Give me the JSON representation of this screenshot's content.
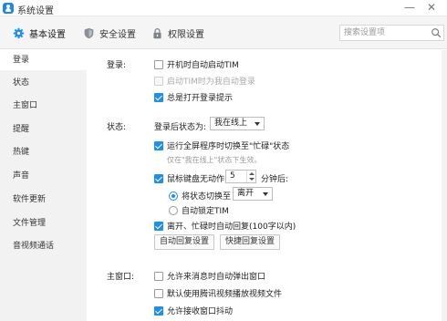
{
  "window": {
    "title": "系统设置",
    "minimize_glyph": "—",
    "close_glyph": "✕"
  },
  "tabs": [
    {
      "label": "基本设置",
      "icon": "gear-icon"
    },
    {
      "label": "安全设置",
      "icon": "shield-icon"
    },
    {
      "label": "权限设置",
      "icon": "lock-icon"
    }
  ],
  "search": {
    "placeholder": "搜索设置项",
    "value": ""
  },
  "sidebar": {
    "items": [
      {
        "label": "登录",
        "active": true
      },
      {
        "label": "状态"
      },
      {
        "label": "主窗口"
      },
      {
        "label": "提醒"
      },
      {
        "label": "热键"
      },
      {
        "label": "声音"
      },
      {
        "label": "软件更新"
      },
      {
        "label": "文件管理"
      },
      {
        "label": "音视频通话"
      }
    ]
  },
  "login": {
    "section_label": "登录:",
    "auto_start": {
      "label": "开机时自动启动TIM",
      "checked": false
    },
    "auto_login": {
      "label": "启动TIM时为我自动登录",
      "checked": false,
      "disabled": true
    },
    "show_prompt": {
      "label": "总是打开登录提示",
      "checked": true
    }
  },
  "status": {
    "section_label": "状态:",
    "after_login_label": "登录后状态为:",
    "after_login_value": "我在线上",
    "fullscreen_busy": {
      "label": "运行全屏程序时切换至\"忙碌\"状态",
      "checked": true
    },
    "fullscreen_hint": "仅在\"我在线上\"状态下生效。",
    "idle": {
      "label": "鼠标键盘无动作",
      "checked": true
    },
    "idle_minutes": "5",
    "idle_suffix": "分钟后:",
    "switch_radio": {
      "label": "将状态切换至",
      "selected": true
    },
    "switch_value": "离开",
    "lock_radio": {
      "label": "自动锁定TIM",
      "selected": false
    },
    "auto_reply": {
      "label": "离开、忙碌时自动回复(100字以内)",
      "checked": true
    },
    "auto_reply_button": "自动回复设置",
    "quick_reply_button": "快捷回复设置"
  },
  "main_window": {
    "section_label": "主窗口:",
    "popup_on_message": {
      "label": "允许来消息时自动弹出窗口",
      "checked": false
    },
    "tencent_video": {
      "label": "默认使用腾讯视频播放视频文件",
      "checked": false
    },
    "window_shake": {
      "label": "允许接收窗口抖动",
      "checked": true
    }
  },
  "colors": {
    "accent": "#1d8ff0",
    "sidebar_bg": "#f2f2f2",
    "tabbar_bg": "#f5f5f5"
  }
}
